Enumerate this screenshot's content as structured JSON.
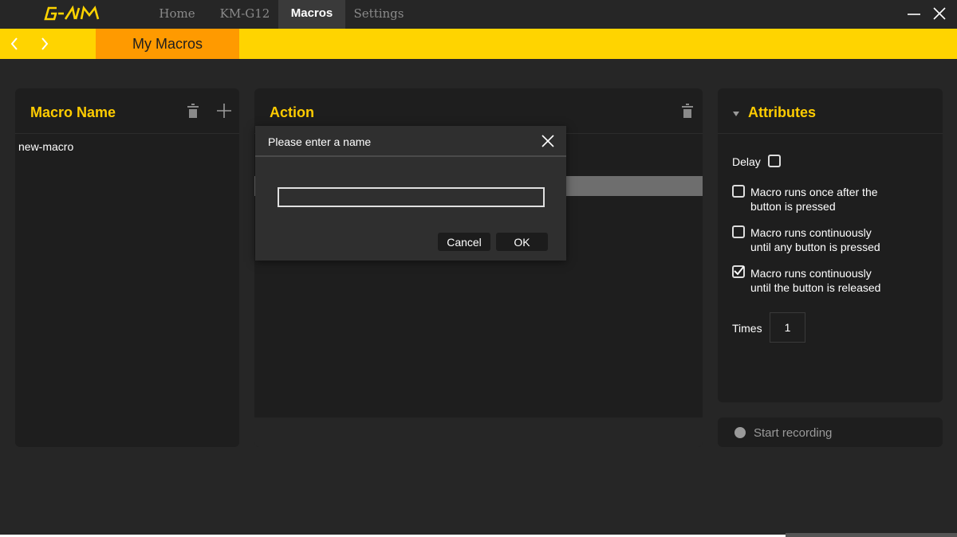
{
  "app": {
    "logo": "G-AIM"
  },
  "nav": {
    "tabs": [
      {
        "label": "Home",
        "active": false
      },
      {
        "label": "KM-G12",
        "active": false
      },
      {
        "label": "Macros",
        "active": true
      },
      {
        "label": "Settings",
        "active": false
      }
    ]
  },
  "subnav": {
    "prev_icon": "chevron-left-icon",
    "next_icon": "chevron-right-icon",
    "active_label": "My Macros"
  },
  "macro_panel": {
    "title": "Macro Name",
    "items": [
      "new-macro"
    ]
  },
  "action_panel": {
    "title": "Action"
  },
  "attributes": {
    "title": "Attributes",
    "delay_label": "Delay",
    "delay_checked": false,
    "options": [
      {
        "line1": "Macro runs once after the",
        "line2": "button is pressed",
        "checked": false
      },
      {
        "line1": "Macro runs continuously",
        "line2": "until any button is pressed",
        "checked": false
      },
      {
        "line1": "Macro runs continuously",
        "line2": "until the button is released",
        "checked": true
      }
    ],
    "times_label": "Times",
    "times_value": "1"
  },
  "recording": {
    "label": "Start recording"
  },
  "dialog": {
    "title": "Please enter a name",
    "input_value": "",
    "cancel_label": "Cancel",
    "ok_label": "OK"
  },
  "colors": {
    "accent_yellow": "#ffd400",
    "accent_orange": "#ff9a00",
    "title_yellow": "#ffcc00",
    "background": "#262626",
    "panel": "#1e1e1e"
  }
}
